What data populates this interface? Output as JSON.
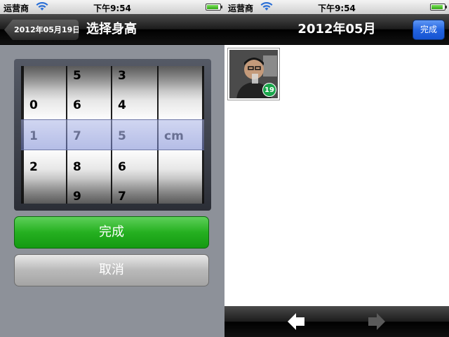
{
  "status_bar": {
    "carrier": "运营商",
    "time": "下午9:54",
    "battery_level": 0.9
  },
  "left_screen": {
    "nav": {
      "back_label": "2012年05月19日",
      "title": "选择身高"
    },
    "picker": {
      "columns": [
        {
          "options": [
            "",
            "0",
            "1",
            "2",
            ""
          ],
          "selected": "1"
        },
        {
          "options": [
            "5",
            "6",
            "7",
            "8",
            "9"
          ],
          "selected": "7"
        },
        {
          "options": [
            "3",
            "4",
            "5",
            "6",
            "7"
          ],
          "selected": "5"
        },
        {
          "options": [
            "",
            "",
            "cm",
            "",
            ""
          ],
          "selected": "cm"
        }
      ]
    },
    "buttons": {
      "finish": "完成",
      "cancel": "取消"
    }
  },
  "right_screen": {
    "nav": {
      "title": "2012年05月",
      "done_label": "完成"
    },
    "photos": [
      {
        "badge": "19"
      }
    ],
    "toolbar": {
      "prev_icon": "arrow-left-icon",
      "next_icon": "arrow-right-icon"
    }
  },
  "colors": {
    "finish_green": "#25b020",
    "done_blue": "#2364e0",
    "badge_green": "#1aa64b"
  }
}
